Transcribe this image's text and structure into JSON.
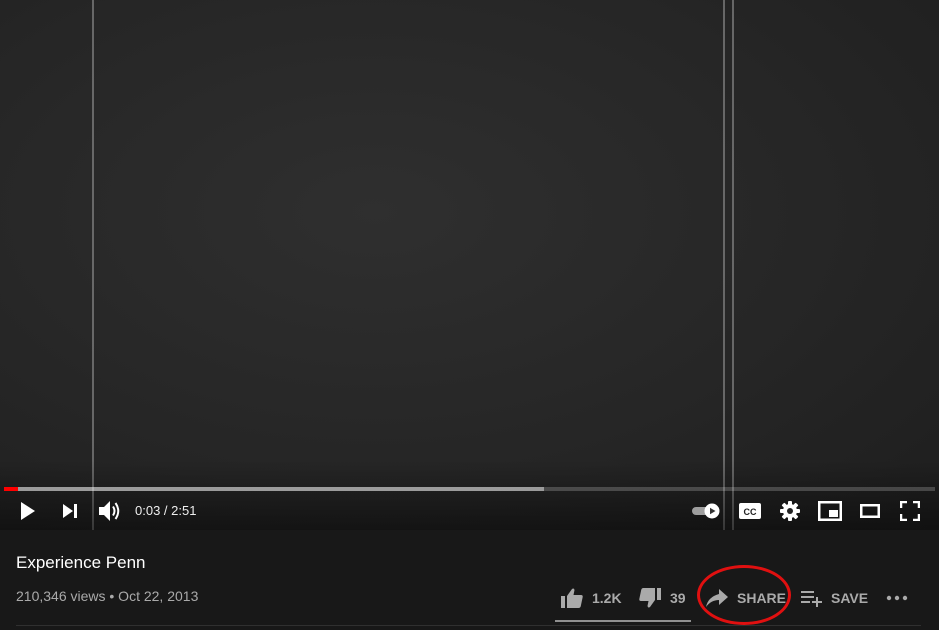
{
  "player": {
    "current_time": "0:03",
    "separator": "/",
    "duration": "2:51",
    "time_display": "0:03 / 2:51",
    "played_fraction": 0.006,
    "buffered_fraction": 0.58,
    "progress_color": "#ff0000",
    "autoplay_on": true,
    "controls": [
      {
        "name": "play-button",
        "icon": "play-icon"
      },
      {
        "name": "next-button",
        "icon": "skip-next-icon"
      },
      {
        "name": "volume-button",
        "icon": "volume-icon"
      },
      {
        "name": "autoplay-toggle",
        "icon": "autoplay-toggle-icon"
      },
      {
        "name": "subtitles-button",
        "icon": "cc-icon"
      },
      {
        "name": "settings-button",
        "icon": "gear-icon"
      },
      {
        "name": "miniplayer-button",
        "icon": "miniplayer-icon"
      },
      {
        "name": "theater-mode-button",
        "icon": "theater-icon"
      },
      {
        "name": "fullscreen-button",
        "icon": "fullscreen-icon"
      }
    ]
  },
  "video": {
    "title": "Experience Penn",
    "views": "210,346 views",
    "dot": "•",
    "date": "Oct 22, 2013",
    "meta_line": "210,346 views • Oct 22, 2013"
  },
  "actions": {
    "likes": "1.2K",
    "dislikes": "39",
    "share_label": "SHARE",
    "save_label": "SAVE",
    "more_icon": "more-horizontal-icon",
    "highlight_color": "#e01010"
  }
}
